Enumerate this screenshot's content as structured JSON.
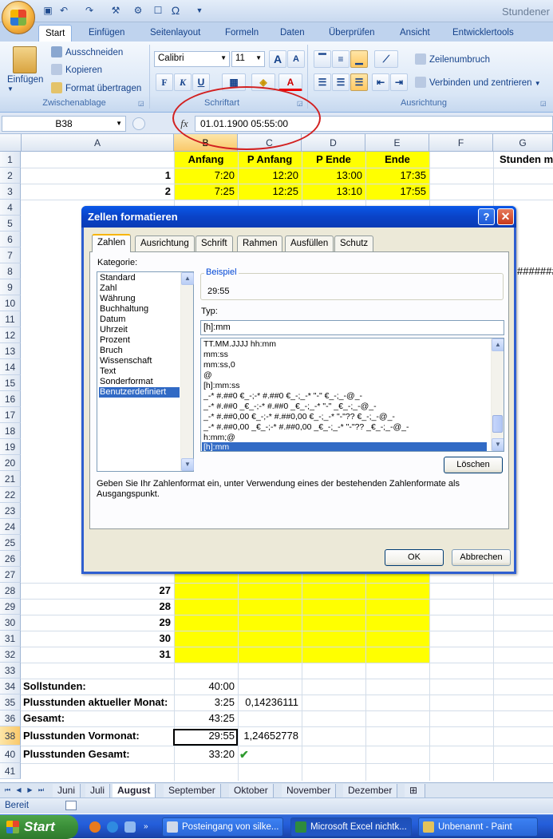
{
  "app": {
    "title": "Stundener",
    "colors": {
      "ribbon_blue": "#bfd3ee",
      "accent_yellow": "#ffff00",
      "selection_blue": "#316ac5",
      "oval_red": "#d22020"
    }
  },
  "qat": {
    "icons": [
      "save-icon",
      "undo-icon",
      "redo-icon",
      "tool-icon",
      "tool2-icon",
      "format-icon",
      "omega-icon"
    ],
    "omega": "Ω"
  },
  "ribbon": {
    "tabs": [
      "Start",
      "Einfügen",
      "Seitenlayout",
      "Formeln",
      "Daten",
      "Überprüfen",
      "Ansicht",
      "Entwicklertools"
    ],
    "clipboard": {
      "paste": "Einfügen",
      "cut": "Ausschneiden",
      "copy": "Kopieren",
      "format_painter": "Format übertragen",
      "group": "Zwischenablage"
    },
    "font": {
      "name": "Calibri",
      "size": "11",
      "grow": "A",
      "shrink": "A",
      "bold": "F",
      "italic": "K",
      "underline": "U",
      "color": "A",
      "group": "Schriftart"
    },
    "alignment": {
      "wrap": "Zeilenumbruch",
      "merge": "Verbinden und zentrieren",
      "group": "Ausrichtung"
    }
  },
  "formula_bar": {
    "cell_ref": "B38",
    "fx": "fx",
    "value": "01.01.1900  05:55:00"
  },
  "sheet": {
    "columns": [
      "A",
      "B",
      "C",
      "D",
      "E",
      "F",
      "G"
    ],
    "rows": [
      "1",
      "2",
      "3",
      "4",
      "5",
      "6",
      "7",
      "8",
      "9",
      "10",
      "11",
      "12",
      "13",
      "14",
      "15",
      "16",
      "17",
      "18",
      "19",
      "20",
      "21",
      "22",
      "23",
      "24",
      "25",
      "26",
      "27",
      "28",
      "29",
      "30",
      "31",
      "32",
      "33",
      "34",
      "35",
      "36",
      "38",
      "40",
      "41"
    ],
    "headers": {
      "b": "Anfang",
      "c": "P Anfang",
      "d": "P Ende",
      "e": "Ende",
      "g": "Stunden m"
    },
    "data_rows": [
      {
        "a": "1",
        "b": "7:20",
        "c": "12:20",
        "d": "13:00",
        "e": "17:35"
      },
      {
        "a": "2",
        "b": "7:25",
        "c": "12:25",
        "d": "13:10",
        "e": "17:55"
      }
    ],
    "lower_rows": [
      "27",
      "28",
      "29",
      "30",
      "31"
    ],
    "overflow": "#######",
    "summary": {
      "soll_label": "Sollstunden:",
      "soll_value": "40:00",
      "plus_label": "Plusstunden aktueller Monat:",
      "plus_value": "3:25",
      "plus_decimal": "0,14236111",
      "gesamt_label": "Gesamt:",
      "gesamt_value": "43:25",
      "vormonat_label": "Plusstunden Vormonat:",
      "vormonat_value": "29:55",
      "vormonat_decimal": "1,24652778",
      "plus_gesamt_label": "Plusstunden Gesamt:",
      "plus_gesamt_value": "33:20",
      "check": "✔"
    }
  },
  "sheet_tabs": [
    "Juni",
    "Juli",
    "August",
    "September",
    "Oktober",
    "November",
    "Dezember"
  ],
  "status": {
    "text": "Bereit"
  },
  "dialog": {
    "title": "Zellen formatieren",
    "help": "?",
    "close": "✕",
    "tabs": [
      "Zahlen",
      "Ausrichtung",
      "Schrift",
      "Rahmen",
      "Ausfüllen",
      "Schutz"
    ],
    "category_label": "Kategorie:",
    "categories": [
      "Standard",
      "Zahl",
      "Währung",
      "Buchhaltung",
      "Datum",
      "Uhrzeit",
      "Prozent",
      "Bruch",
      "Wissenschaft",
      "Text",
      "Sonderformat",
      "Benutzerdefiniert"
    ],
    "sample_label": "Beispiel",
    "sample_value": "29:55",
    "type_label": "Typ:",
    "type_value": "[h]:mm",
    "formats": [
      "TT.MM.JJJJ hh:mm",
      "mm:ss",
      "mm:ss,0",
      "@",
      "[h]:mm:ss",
      "_-* #.##0 €_-;-* #.##0 €_-;_-* \"-\" €_-;_-@_-",
      "_-* #.##0 _€_-;-* #.##0 _€_-;_-* \"-\" _€_-;_-@_-",
      "_-* #.##0,00 €_-;-* #.##0,00 €_-;_-* \"-\"?? €_-;_-@_-",
      "_-* #.##0,00 _€_-;-* #.##0,00 _€_-;_-* \"-\"?? _€_-;_-@_-",
      "h:mm;@",
      "[h]:mm"
    ],
    "delete": "Löschen",
    "hint": "Geben Sie Ihr Zahlenformat ein, unter Verwendung eines der bestehenden Zahlenformate als Ausgangspunkt.",
    "ok": "OK",
    "cancel": "Abbrechen"
  },
  "taskbar": {
    "start": "Start",
    "items": [
      "Posteingang von silke...",
      "Microsoft Excel nichtk...",
      "Unbenannt - Paint"
    ]
  }
}
